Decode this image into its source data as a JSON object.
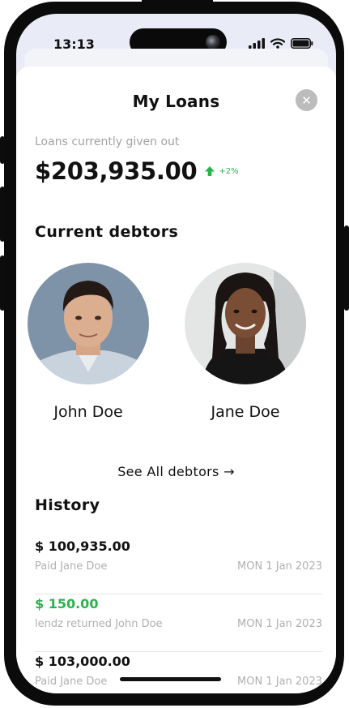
{
  "status_bar": {
    "time": "13:13"
  },
  "sheet": {
    "title": "My Loans",
    "close_icon": "close-icon",
    "loans_caption": "Loans currently given out",
    "total_amount": "$203,935.00",
    "trend_percent": "+2%",
    "trend_color": "#2bb24c"
  },
  "debtors": {
    "section_title": "Current debtors",
    "items": [
      {
        "name": "John Doe"
      },
      {
        "name": "Jane Doe"
      }
    ],
    "see_all_label": "See All debtors →"
  },
  "history": {
    "section_title": "History",
    "items": [
      {
        "amount": "$ 100,935.00",
        "description": "Paid Jane Doe",
        "date": "MON 1 Jan 2023",
        "amount_color": "#111111"
      },
      {
        "amount": "$ 150.00",
        "description": "lendz returned John Doe",
        "date": "MON 1 Jan 2023",
        "amount_color": "#2bb24c"
      },
      {
        "amount": "$ 103,000.00",
        "description": "Paid Jane Doe",
        "date": "MON 1 Jan 2023",
        "amount_color": "#111111"
      }
    ]
  }
}
